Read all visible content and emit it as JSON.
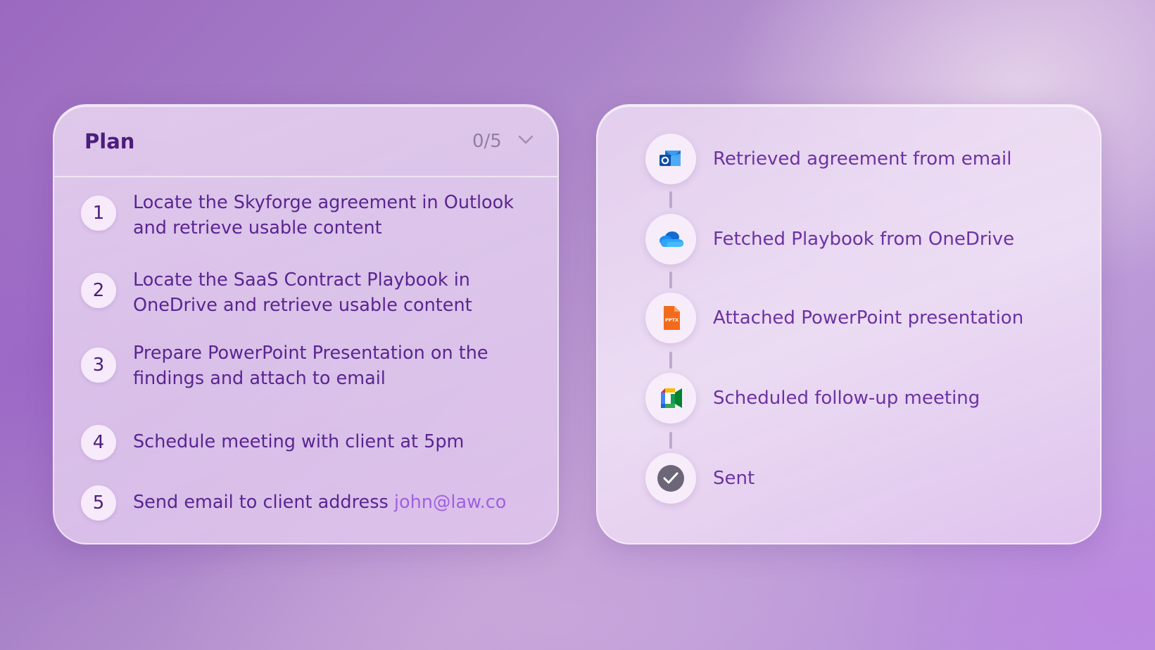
{
  "plan": {
    "title": "Plan",
    "progress": "0/5",
    "steps": [
      {
        "number": "1",
        "line1": "Locate the Skyforge agreement in Outlook",
        "line2": "and retrieve usable content"
      },
      {
        "number": "2",
        "line1": "Locate the SaaS Contract Playbook in",
        "line2": "OneDrive and retrieve usable content"
      },
      {
        "number": "3",
        "line1": "Prepare PowerPoint Presentation on the",
        "line2": "findings and attach to email"
      },
      {
        "number": "4",
        "line1": "Schedule meeting with client at 5pm"
      },
      {
        "number": "5",
        "line1": "Send email to client address ",
        "email": "john@law.co"
      }
    ]
  },
  "activity": {
    "items": [
      {
        "label": "Retrieved agreement from email",
        "icon": "outlook-icon"
      },
      {
        "label": "Fetched Playbook from OneDrive",
        "icon": "onedrive-icon"
      },
      {
        "label": "Attached PowerPoint presentation",
        "icon": "pptx-file-icon",
        "icon_text": "PPTX"
      },
      {
        "label": "Scheduled follow-up meeting",
        "icon": "google-meet-icon"
      },
      {
        "label": "Sent",
        "icon": "check-circle-icon"
      }
    ]
  },
  "colors": {
    "accent_dark": "#4b1d7d",
    "text": "#5a2590",
    "link": "#a060e0",
    "pptx_orange": "#f26b1d"
  }
}
